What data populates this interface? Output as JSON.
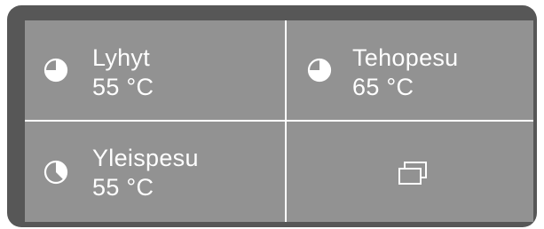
{
  "programs": [
    {
      "name": "Lyhyt",
      "temperature": "55 °C",
      "icon": "pie-three-quarter-icon"
    },
    {
      "name": "Tehopesu",
      "temperature": "65 °C",
      "icon": "pie-three-quarter-icon"
    },
    {
      "name": "Yleispesu",
      "temperature": "55 °C",
      "icon": "pie-five-eighths-icon"
    }
  ],
  "more_button": {
    "icon": "stacked-windows-icon"
  },
  "colors": {
    "frame": "#575757",
    "panel": "#929292",
    "text": "#ffffff",
    "divider": "#ffffff"
  }
}
